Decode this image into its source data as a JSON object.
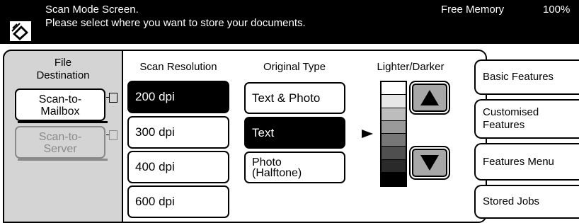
{
  "header": {
    "title": "Scan Mode Screen.",
    "instruction": "Please select where you want to store your documents.",
    "memory_label": "Free Memory",
    "memory_value": "100%",
    "memory_fraction": 1.0,
    "icon": "scanner-icon"
  },
  "file_destination": {
    "label_line1": "File",
    "label_line2": "Destination",
    "options": [
      {
        "line1": "Scan-to-",
        "line2": "Mailbox",
        "enabled": true,
        "icon": "mailbox-door-icon"
      },
      {
        "line1": "Scan-to-",
        "line2": "Server",
        "enabled": false,
        "icon": "server-door-icon"
      }
    ]
  },
  "scan_resolution": {
    "label": "Scan Resolution",
    "options": [
      "200 dpi",
      "300 dpi",
      "400 dpi",
      "600 dpi"
    ],
    "selected": "200 dpi"
  },
  "original_type": {
    "label": "Original Type",
    "options": [
      {
        "line1": "Text & Photo",
        "line2": ""
      },
      {
        "line1": "Text",
        "line2": ""
      },
      {
        "line1": "Photo",
        "line2": "(Halftone)"
      }
    ],
    "selected": "Text"
  },
  "lighter_darker": {
    "label": "Lighter/Darker",
    "levels": 7,
    "selected_level": 4,
    "shades": [
      "#ffffff",
      "#e6e6e6",
      "#bdbdbd",
      "#9a9a9a",
      "#777777",
      "#4f4f4f",
      "#2a2a2a",
      "#000000"
    ],
    "up_icon": "triangle-up-icon",
    "down_icon": "triangle-down-icon",
    "indicator_icon": "pointer-right-icon"
  },
  "side_tabs": {
    "basic": "Basic Features",
    "customised_line1": "Customised",
    "customised_line2": "Features",
    "menu": "Features Menu",
    "stored": "Stored Jobs"
  },
  "colors": {
    "header_bg": "#000000",
    "panel_gray": "#d4d4d4",
    "disabled_text": "#8a8a8a",
    "arrow_button": "#a8a8a8"
  }
}
